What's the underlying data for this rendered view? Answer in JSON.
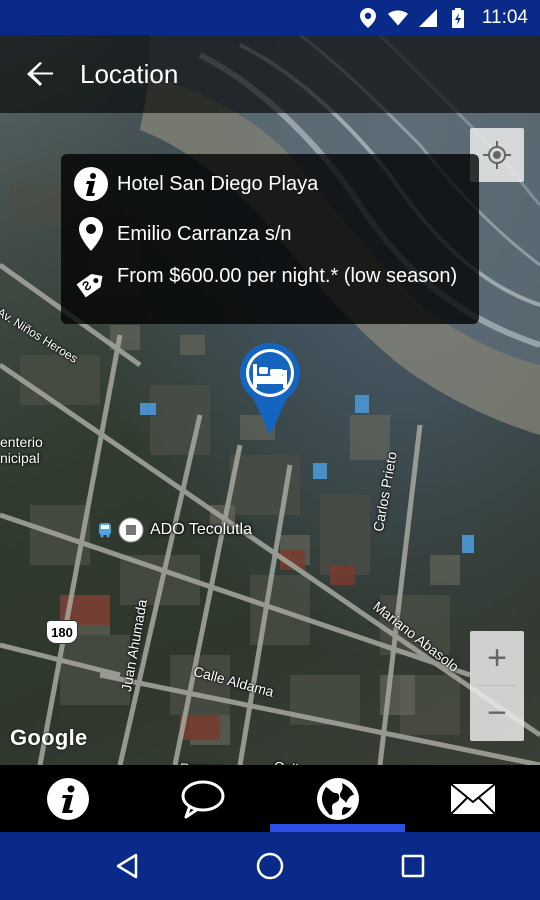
{
  "status_bar": {
    "time": "11:04",
    "icons": [
      "location-icon",
      "wifi-icon",
      "signal-icon",
      "battery-icon"
    ]
  },
  "app_bar": {
    "title": "Location",
    "back_icon": "arrow-back-icon"
  },
  "info_card": {
    "name": "Hotel San Diego Playa",
    "address": "Emilio Carranza s/n",
    "price": "From $600.00 per night.* (low season)"
  },
  "map": {
    "poi_label": "ADO Tecolutla",
    "road_labels": {
      "ninos_heroes": "Av. Niños Heroes",
      "cementerio": "enterio\nnicipal",
      "carlos_prieto": "Carlos Prieto",
      "mariano_abasolo": "Mariano Abasolo",
      "juan_ahumada": "Juan Ahumada",
      "calle_aldama": "Calle Aldama",
      "calle_guerrero": "Calle Guerrero",
      "parque": "Parque"
    },
    "highway_number": "180",
    "attribution": "Google",
    "zoom_in": "+",
    "zoom_out": "−"
  },
  "tabs": [
    {
      "id": "info",
      "icon": "info-icon",
      "active": false
    },
    {
      "id": "comments",
      "icon": "speech-bubble-icon",
      "active": false
    },
    {
      "id": "location",
      "icon": "globe-icon",
      "active": true
    },
    {
      "id": "contact",
      "icon": "envelope-icon",
      "active": false
    }
  ],
  "colors": {
    "status_bar": "#0a2a8a",
    "nav_bar": "#0a2a8a",
    "active_tab_indicator": "#2e4fe6",
    "marker": "#1565c0"
  }
}
